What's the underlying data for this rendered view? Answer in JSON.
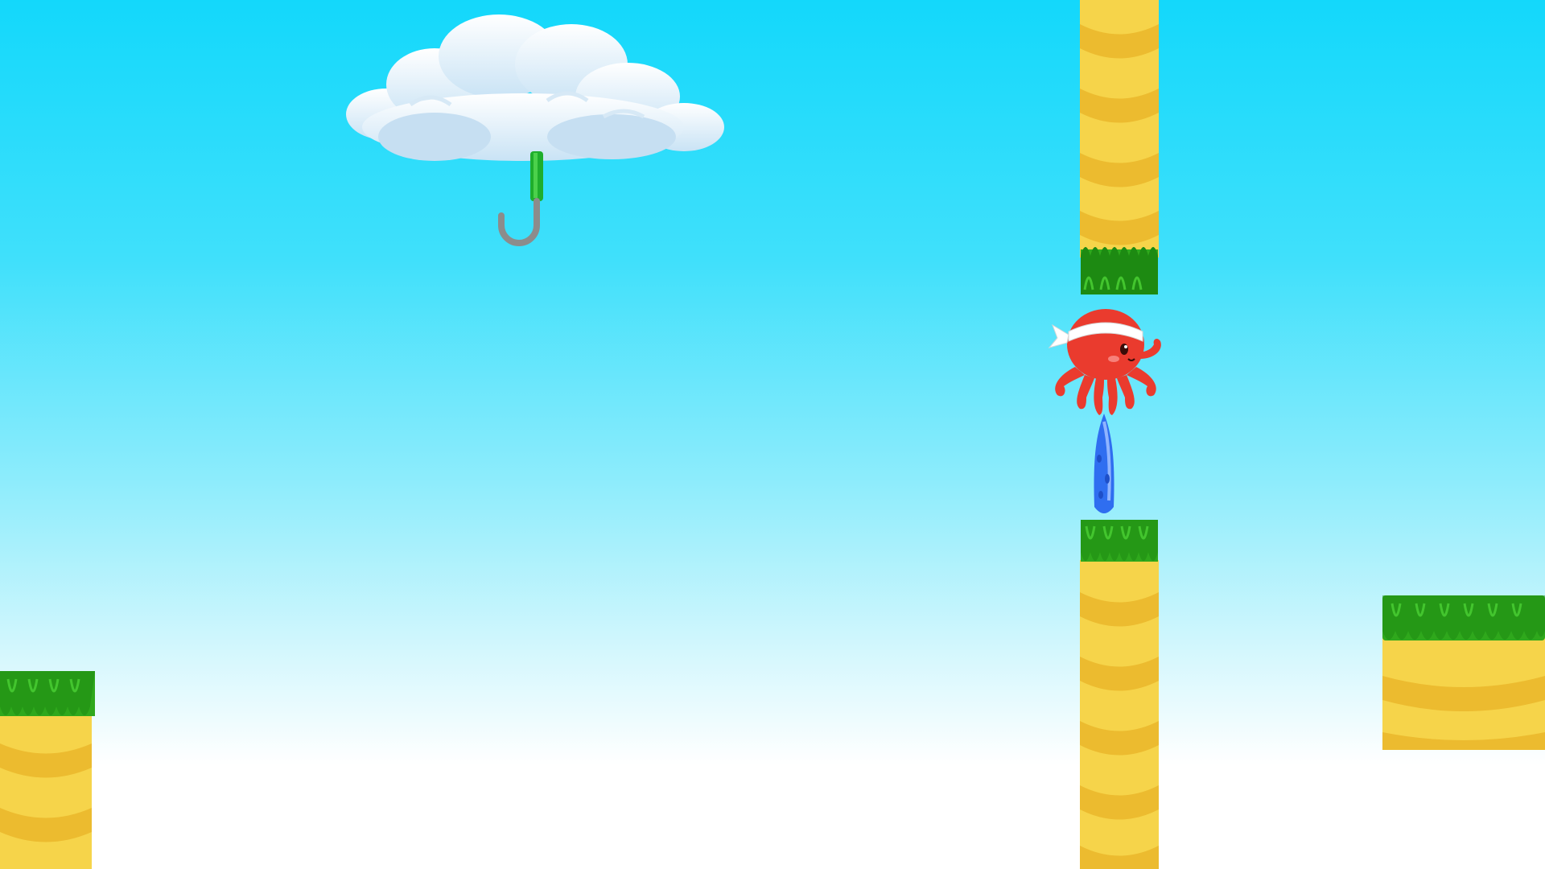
{
  "scene": {
    "sky": {
      "top_color": "#13d8fb",
      "bottom_color": "#ffffff"
    },
    "colors": {
      "grass": "#2fa81c",
      "grass_dark": "#1d8a12",
      "sand": "#f6d44a",
      "sand_stripe": "#ecbb2f",
      "octopus": "#ea3b2e",
      "headband": "#ffffff",
      "water": "#2f6ef0",
      "hook_handle": "#1fae2c",
      "hook_metal": "#8c8c8c"
    },
    "sprites": {
      "cloud": "cloud-with-hook",
      "player": "octopus-with-headband",
      "trail": "water-jet",
      "obstacle": "grass-topped-sand-pillar"
    }
  }
}
